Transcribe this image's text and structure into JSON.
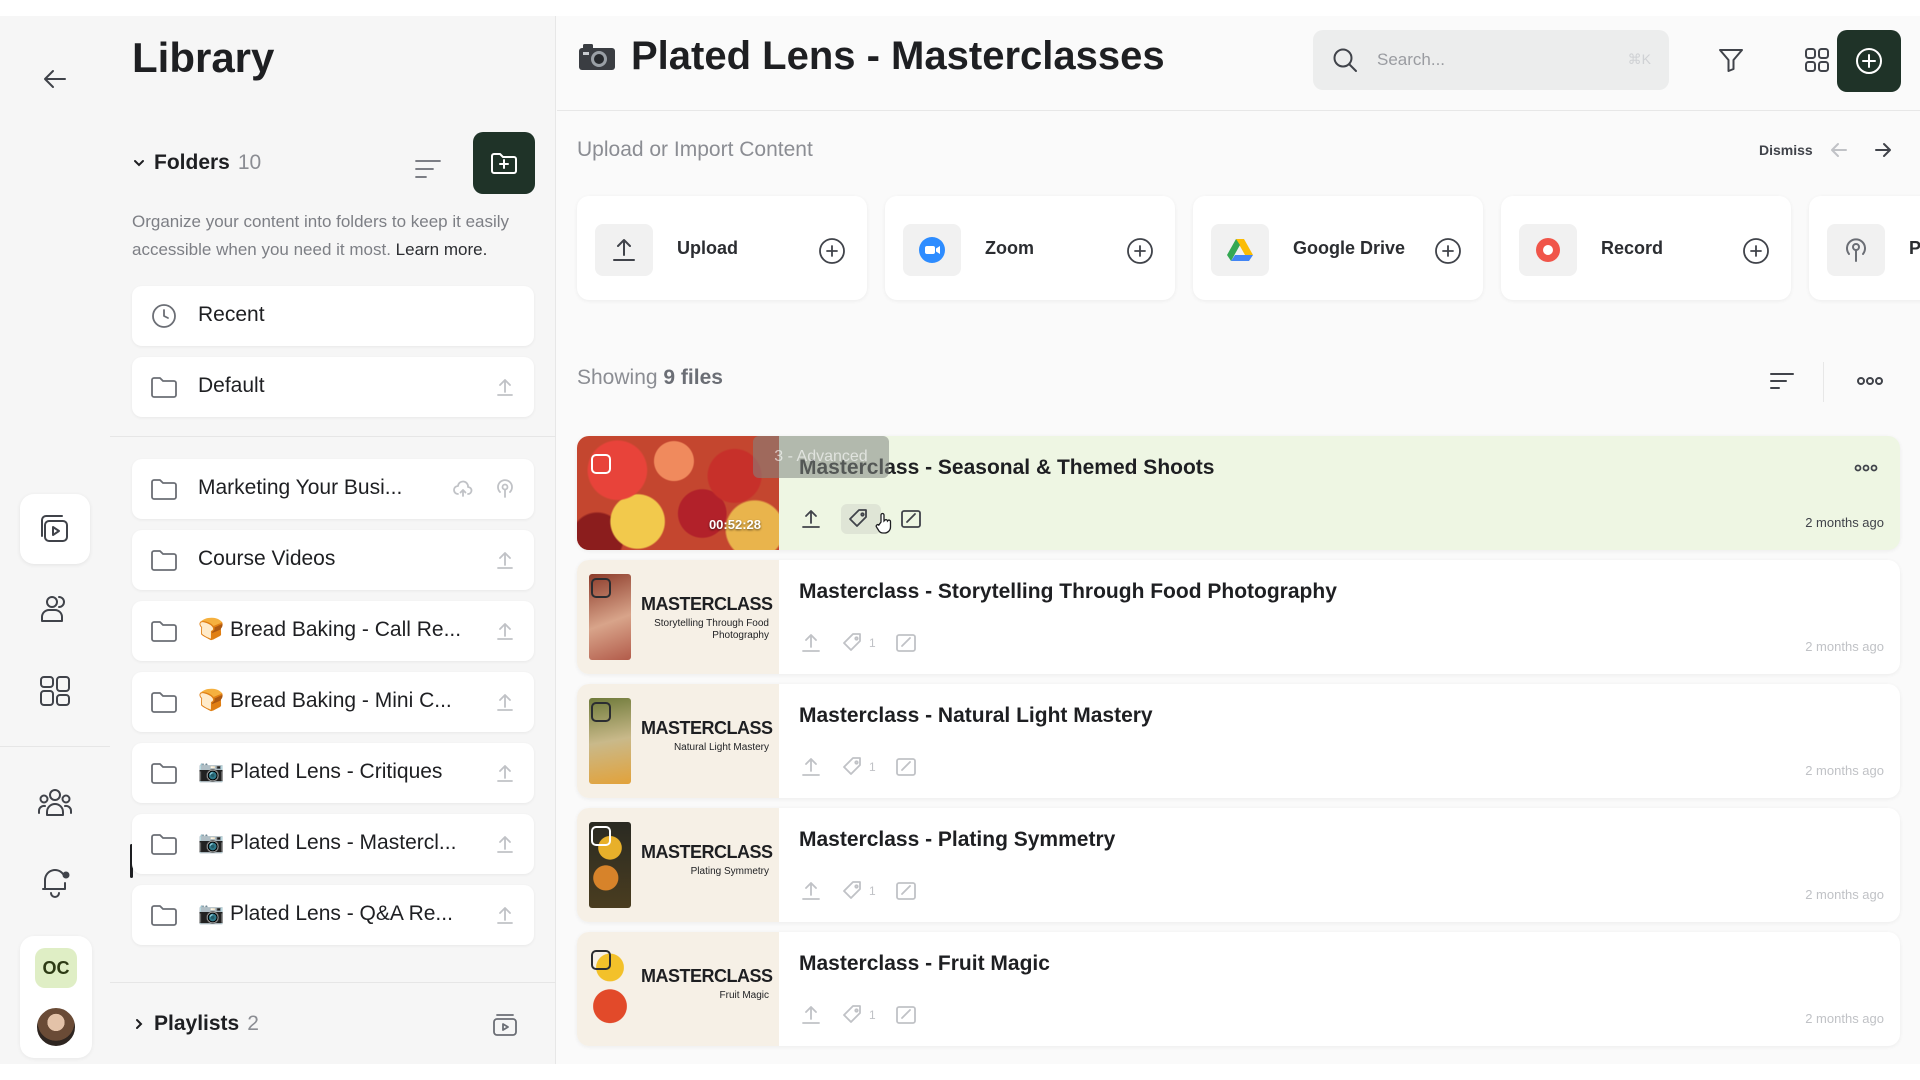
{
  "library": {
    "title": "Library",
    "folders_label": "Folders",
    "folders_count": "10",
    "description": "Organize your content into folders to keep it easily accessible when you need it most.",
    "learn_more": "Learn more.",
    "pinned": [
      {
        "label": "Recent",
        "icon": "clock-icon"
      },
      {
        "label": "Default",
        "icon": "folder-icon"
      }
    ],
    "folders": [
      {
        "label": "Marketing Your Busi...",
        "icon": "folder-icon"
      },
      {
        "label": "Course Videos",
        "icon": "folder-icon"
      },
      {
        "label": "🍞 Bread Baking - Call Re...",
        "icon": "folder-icon"
      },
      {
        "label": "🍞 Bread Baking - Mini C...",
        "icon": "folder-icon"
      },
      {
        "label": "📷 Plated Lens - Critiques",
        "icon": "folder-icon"
      },
      {
        "label": "📷 Plated Lens - Mastercl...",
        "icon": "folder-icon",
        "active": true
      },
      {
        "label": "📷 Plated Lens - Q&A Re...",
        "icon": "folder-icon"
      }
    ],
    "playlists_label": "Playlists",
    "playlists_count": "2"
  },
  "rail": {
    "user_initials": "OC"
  },
  "header": {
    "title": "Plated Lens - Masterclasses",
    "search_placeholder": "Search...",
    "search_shortcut": "⌘K"
  },
  "upload": {
    "title": "Upload or Import Content",
    "dismiss": "Dismiss",
    "sources": [
      {
        "label": "Upload",
        "icon": "upload-icon"
      },
      {
        "label": "Zoom",
        "icon": "zoom-icon"
      },
      {
        "label": "Google Drive",
        "icon": "google-drive-icon"
      },
      {
        "label": "Record",
        "icon": "record-icon"
      },
      {
        "label": "Po",
        "icon": "podcast-icon"
      }
    ]
  },
  "list": {
    "showing_prefix": "Showing",
    "showing_count": "9 files",
    "tooltip": "3 - Advanced",
    "files": [
      {
        "title": "Masterclass - Seasonal & Themed Shoots",
        "duration": "00:52:28",
        "tag_count": "",
        "date": "2 months ago",
        "highlighted": true
      },
      {
        "title": "Masterclass - Storytelling Through Food Photography",
        "thumb_title": "MASTERCLASS",
        "thumb_sub": "Storytelling Through Food Photography",
        "tag_count": "1",
        "date": "2 months ago"
      },
      {
        "title": "Masterclass - Natural Light Mastery",
        "thumb_title": "MASTERCLASS",
        "thumb_sub": "Natural Light Mastery",
        "tag_count": "1",
        "date": "2 months ago"
      },
      {
        "title": "Masterclass - Plating Symmetry",
        "thumb_title": "MASTERCLASS",
        "thumb_sub": "Plating Symmetry",
        "tag_count": "1",
        "date": "2 months ago"
      },
      {
        "title": "Masterclass - Fruit Magic",
        "thumb_title": "MASTERCLASS",
        "thumb_sub": "Fruit Magic",
        "tag_count": "1",
        "date": "2 months ago"
      }
    ]
  },
  "colors": {
    "accent_dark": "#1f3328",
    "highlight_row": "#eef6e3",
    "badge": "#dfeec5"
  }
}
